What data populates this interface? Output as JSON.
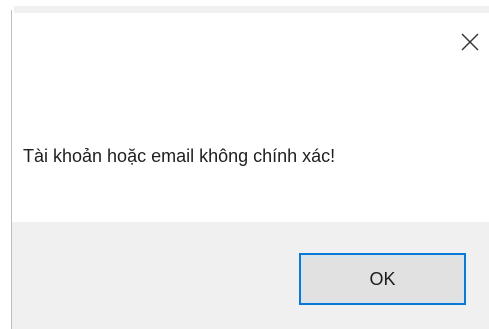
{
  "dialog": {
    "message": "Tài khoản hoặc email không chính xác!",
    "ok_label": "OK",
    "close_icon": "close-icon"
  },
  "colors": {
    "button_border": "#0a78d7",
    "button_background": "#e1e1e1",
    "footer_background": "#f0f0f0",
    "text": "#1e1e1e"
  }
}
